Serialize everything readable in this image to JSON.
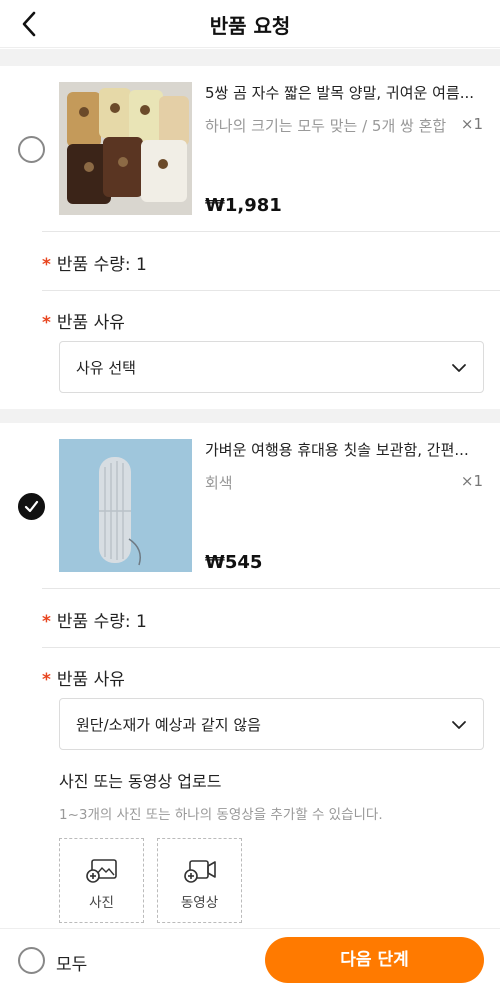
{
  "header": {
    "title": "반품 요청",
    "back_icon": "chevron-left-icon"
  },
  "items": [
    {
      "selected": false,
      "name": "5쌍 곰 자수 짧은 발목 양말, 귀여운 여름...",
      "option": "하나의 크기는 모두 맞는 / 5개 쌍 혼합",
      "qty": "×1",
      "price": "₩1,981",
      "qty_label": "반품 수량:",
      "qty_value": "1",
      "reason_label": "반품 사유",
      "reason_value": "사유 선택",
      "image": "bear-socks-image"
    },
    {
      "selected": true,
      "name": "가벼운 여행용 휴대용 칫솔 보관함, 간편...",
      "option": "회색",
      "qty": "×1",
      "price": "₩545",
      "qty_label": "반품 수량:",
      "qty_value": "1",
      "reason_label": "반품 사유",
      "reason_value": "원단/소재가 예상과 같지 않음",
      "image": "toothbrush-case-image"
    }
  ],
  "upload": {
    "title": "사진 또는 동영상 업로드",
    "hint": "1~3개의 사진 또는 하나의 동영상을 추가할 수 있습니다.",
    "photo_label": "사진",
    "video_label": "동영상"
  },
  "footer": {
    "all_label": "모두",
    "next_label": "다음 단계"
  },
  "colors": {
    "accent": "#ff7a00",
    "required": "#e8451f"
  }
}
